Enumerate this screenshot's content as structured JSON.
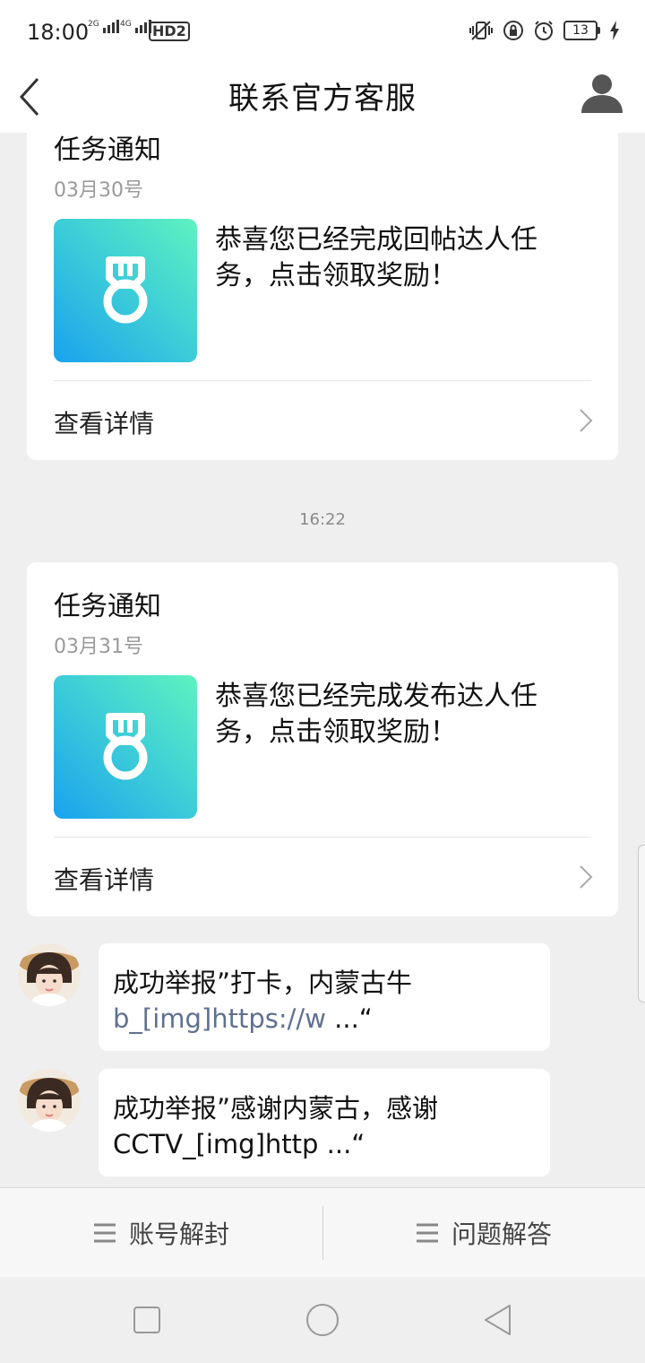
{
  "status_bar": {
    "time": "18:00",
    "network1": "2G",
    "network2": "4G",
    "hd_label": "HD2",
    "battery": "13",
    "icons": [
      "vibrate-icon",
      "lock-rotation-icon",
      "alarm-icon",
      "battery-icon",
      "charging-icon"
    ]
  },
  "header": {
    "title": "联系官方客服",
    "back_icon": "chevron-left-icon",
    "profile_icon": "user-icon"
  },
  "messages": [
    {
      "type": "task_card",
      "title": "任务通知",
      "date": "03月30号",
      "text": "恭喜您已经完成回帖达人任务，点击领取奖励！",
      "detail_label": "查看详情"
    },
    {
      "type": "timestamp",
      "time": "16:22"
    },
    {
      "type": "task_card",
      "title": "任务通知",
      "date": "03月31号",
      "text": "恭喜您已经完成发布达人任务，点击领取奖励！",
      "detail_label": "查看详情"
    },
    {
      "type": "chat",
      "line1": "成功举报”打卡，内蒙古牛",
      "link": "b_[img]https://w",
      "suffix": " ...“"
    },
    {
      "type": "chat",
      "line1": "成功举报”感谢内蒙古，感谢",
      "line2": "CCTV_[img]http ...“"
    }
  ],
  "bottom_menu": {
    "left_label": "账号解封",
    "right_label": "问题解答",
    "icon": "menu-icon"
  },
  "colors": {
    "background": "#efefef",
    "card": "#ffffff",
    "link": "#5f7090",
    "tile_gradient_start": "#5ef2c0",
    "tile_gradient_end": "#1aa2ee"
  }
}
